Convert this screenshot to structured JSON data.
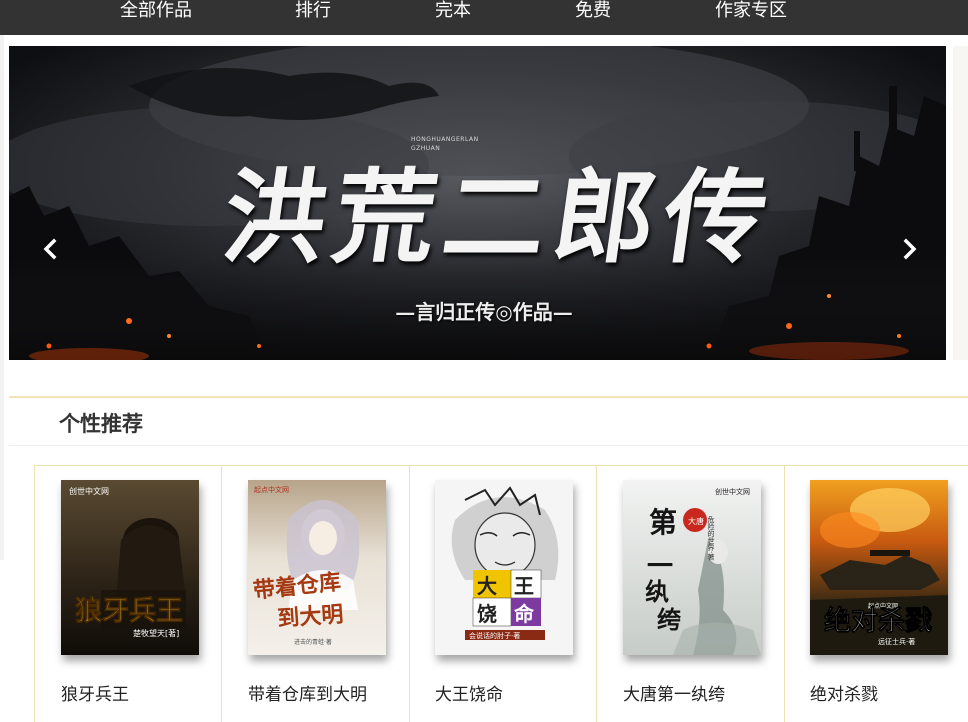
{
  "nav": {
    "items": [
      "全部作品",
      "排行",
      "完本",
      "免费",
      "作家专区"
    ]
  },
  "banner": {
    "latin_title": "HONGHUANGERLAN GZHUAN",
    "title": "洪荒二郎传",
    "author_line": "—言归正传◎作品—"
  },
  "recommend": {
    "title": "个性推荐",
    "books": [
      {
        "name": "狼牙兵王",
        "cover_title": "狼牙兵王",
        "cover_author": "楚牧望天[著]",
        "cover_publisher": "创世中文网",
        "cover_color": "#2b2216"
      },
      {
        "name": "带着仓库到大明",
        "cover_title": "带着仓库到大明",
        "cover_author": "进击的青蛙·著",
        "cover_publisher": "起点中文网",
        "cover_color": "#d9d2c8"
      },
      {
        "name": "大王饶命",
        "cover_title": "大王饶命",
        "cover_author": "会说话的肘子·著",
        "cover_publisher": "",
        "cover_color": "#eeeeee"
      },
      {
        "name": "大唐第一纨绔",
        "cover_title": "第一纨绔",
        "cover_author": "危险的世界·著",
        "cover_publisher": "创世中文网",
        "cover_color": "#e4e6e3"
      },
      {
        "name": "绝对杀戮",
        "cover_title": "绝对杀戮",
        "cover_author": "远征士兵·著",
        "cover_publisher": "起点中文网",
        "cover_color": "#3a2a12"
      }
    ]
  },
  "colors": {
    "nav_bg": "#333333",
    "accent_line": "#f3e3b6",
    "card_border": "#f0e1b4"
  },
  "icons": {
    "prev": "chevron-left-icon",
    "next": "chevron-right-icon"
  }
}
